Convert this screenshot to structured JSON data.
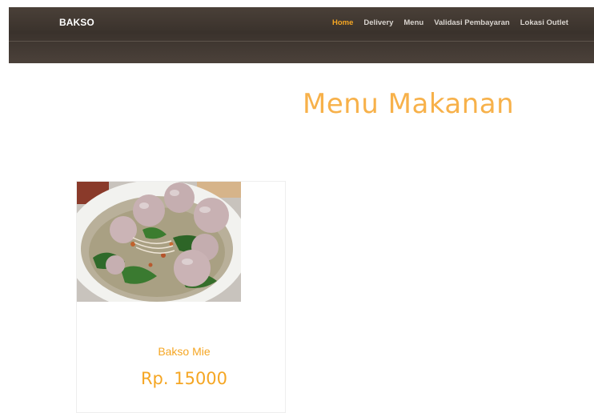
{
  "navbar": {
    "brand": "BAKSO",
    "links": [
      {
        "label": "Home",
        "active": true
      },
      {
        "label": "Delivery",
        "active": false
      },
      {
        "label": "Menu",
        "active": false
      },
      {
        "label": "Validasi Pembayaran",
        "active": false
      },
      {
        "label": "Lokasi Outlet",
        "active": false
      }
    ]
  },
  "main": {
    "title": "Menu Makanan",
    "products": [
      {
        "name": "Bakso Mie",
        "price": "Rp. 15000",
        "image": "bakso-mie-photo"
      }
    ]
  },
  "colors": {
    "accent": "#f5a623",
    "title": "#f7b14a",
    "navbar": "#3f3630"
  }
}
